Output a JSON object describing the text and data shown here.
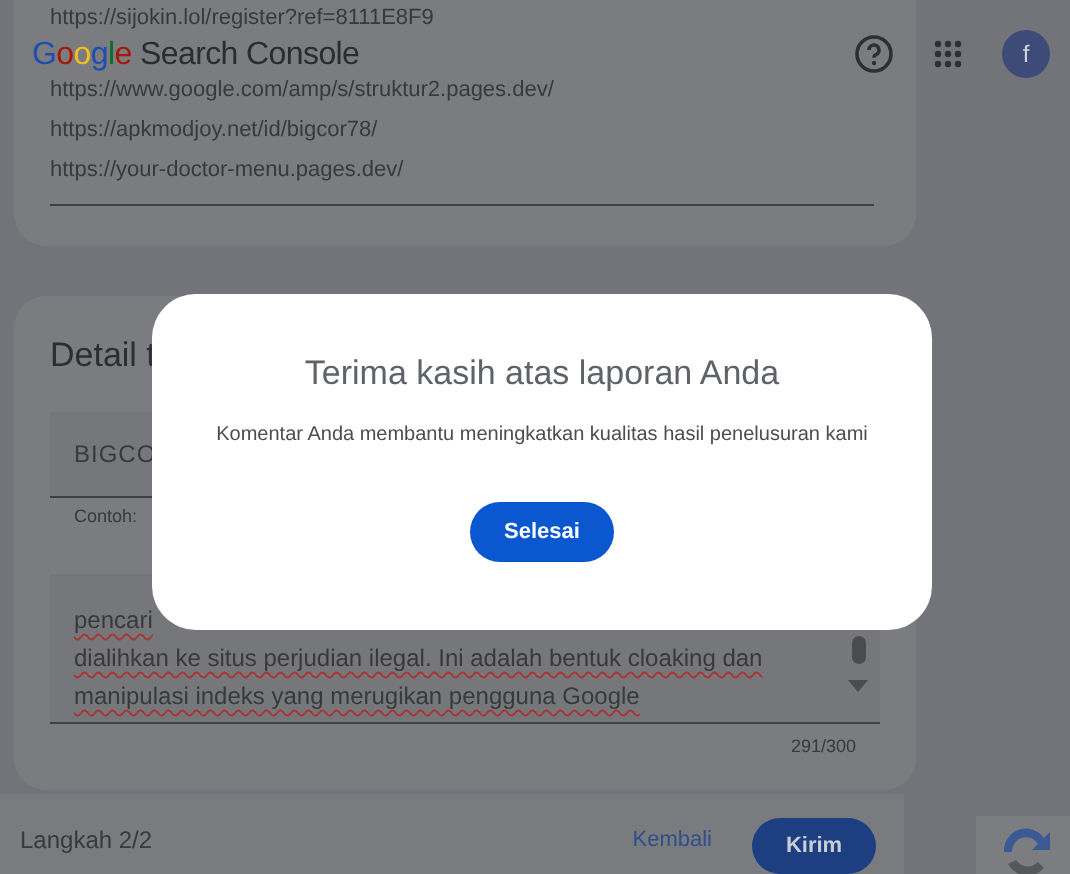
{
  "header": {
    "brand": "Google",
    "product": "Search Console",
    "avatar": "f"
  },
  "examples_card": {
    "links": [
      "https://sijokin.lol/register?ref=8111E8F9",
      "https://www.google.com/amp/s/struktur2.pages.dev/",
      "https://apkmodjoy.net/id/bigcor78/",
      "https://your-doctor-menu.pages.dev/"
    ]
  },
  "details_card": {
    "title": "Detail t",
    "field": {
      "value": "BIGCO",
      "hint": "Contoh: "
    },
    "comment": {
      "lines": [
        "pencari",
        "dialihkan ke situs perjudian ilegal. Ini adalah bentuk cloaking dan",
        "manipulasi indeks yang merugikan pengguna Google"
      ],
      "counter": "291/300"
    }
  },
  "footer": {
    "step": "Langkah 2/2",
    "back": "Kembali",
    "submit": "Kirim"
  },
  "dialog": {
    "title": "Terima kasih atas laporan Anda",
    "message": "Komentar Anda membantu meningkatkan kualitas hasil penelusuran kami",
    "button": "Selesai"
  }
}
